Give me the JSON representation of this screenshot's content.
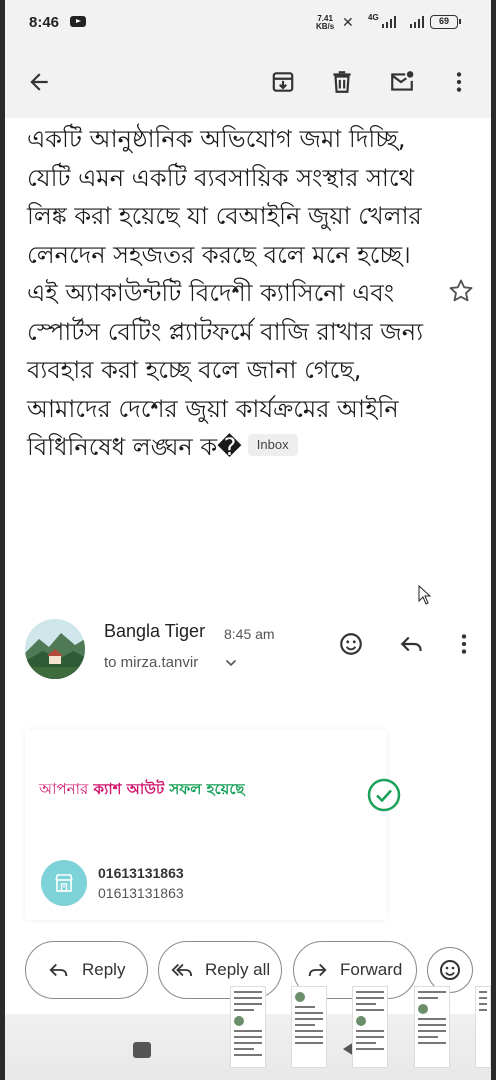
{
  "status_bar": {
    "time": "8:46",
    "net_speed_value": "7.41",
    "net_speed_unit": "KB/s",
    "network": "4G",
    "battery": "69"
  },
  "toolbar": {
    "back": "arrow-back-icon",
    "archive": "archive-icon",
    "delete": "trash-icon",
    "mark_unread": "mark-unread-icon",
    "more": "more-vert-icon"
  },
  "email": {
    "subject": "একটি আনুষ্ঠানিক অভিযোগ জমা দিচ্ছি, যেটি এমন একটি ব্যবসায়িক সংস্থার সাথে লিঙ্ক করা হয়েছে যা বেআইনি জুয়া খেলার লেনদেন সহজতর করছে বলে মনে হচ্ছে। এই অ্যাকাউন্টটি বিদেশী ক্যাসিনো এবং স্পোর্টস বেটিং প্ল্যাটফর্মে বাজি রাখার জন্য ব্যবহার করা হচ্ছে বলে জানা গেছে, আমাদের দেশের জুয়া কার্যক্রমের আইনি বিধিনিষেধ লঙ্ঘন ক�",
    "label": "Inbox",
    "sender_name": "Bangla Tiger",
    "sent_time": "8:45 am",
    "recipient": "to mirza.tanvir"
  },
  "card": {
    "word1": "আপনার",
    "word2": "ক্যাশ আউট",
    "word3": "সফল হয়েছে",
    "number_primary": "01613131863",
    "number_secondary": "01613131863"
  },
  "actions": {
    "reply": "Reply",
    "reply_all": "Reply all",
    "forward": "Forward"
  },
  "colors": {
    "pink": "#d1156f",
    "green": "#1aa15a",
    "teal": "#7dd3d7"
  }
}
